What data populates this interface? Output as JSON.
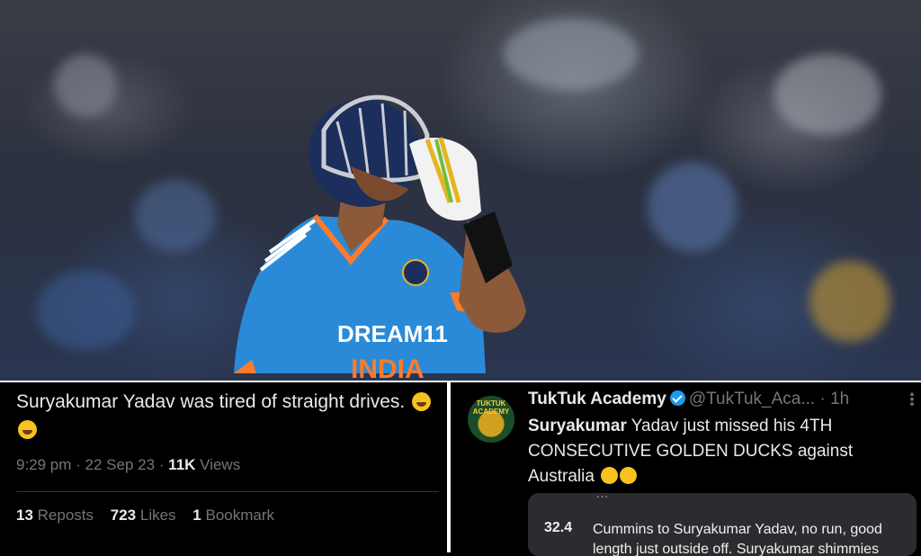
{
  "left_tweet": {
    "text": "Suryakumar Yadav was tired of straight drives.",
    "time": "9:29 pm",
    "date": "22 Sep 23",
    "views_count": "11K",
    "views_label": "Views",
    "reposts_count": "13",
    "reposts_label": "Reposts",
    "likes_count": "723",
    "likes_label": "Likes",
    "bookmarks_count": "1",
    "bookmarks_label": "Bookmark"
  },
  "right_tweet": {
    "avatar_text": "TUKTUK ACADEMY",
    "name": "TukTuk Academy",
    "handle": "@TukTuk_Aca...",
    "age": "1h",
    "body_bold": "Suryakumar",
    "body_rest": " Yadav just missed his 4TH CONSECUTIVE GOLDEN DUCKS against Australia",
    "quote_cut": "…",
    "quote_over": "32.4",
    "quote_text": "Cummins to Suryakumar Yadav, no run, good length just outside off. Suryakumar shimmies"
  },
  "photo": {
    "jersey_sponsor": "DREAM11",
    "jersey_country": "INDIA"
  },
  "colors": {
    "verified": "#1d9bf0",
    "jersey": "#2a8ad8",
    "muted": "#71767b"
  }
}
